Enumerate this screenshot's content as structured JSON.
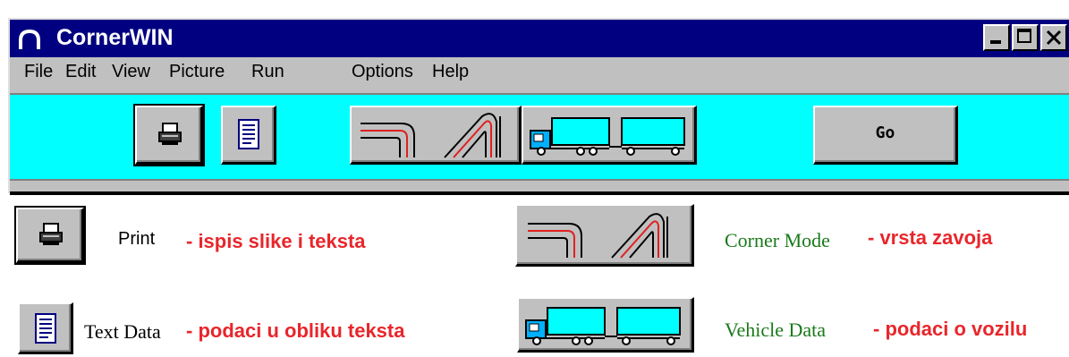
{
  "window": {
    "title": "CornerWIN",
    "controls": [
      "minimize",
      "maximize",
      "close"
    ]
  },
  "menu": {
    "items": [
      "File",
      "Edit",
      "View",
      "Picture",
      "Run",
      "Options",
      "Help"
    ]
  },
  "toolbar": {
    "go_label": "Go",
    "buttons": [
      "printer-icon",
      "text-document-icon",
      "corner-mode-icon",
      "vehicle-icon"
    ],
    "colors": {
      "background": "#00ffff",
      "button": "#c0c0c0",
      "titlebar": "#000080"
    }
  },
  "legend": {
    "print": {
      "label": "Print",
      "desc": "- ispis slike i teksta"
    },
    "text_data": {
      "label": "Text Data",
      "desc": "- podaci u obliku teksta"
    },
    "corner_mode": {
      "label": "Corner Mode",
      "desc": "- vrsta zavoja"
    },
    "vehicle_data": {
      "label": "Vehicle Data",
      "desc": "- podaci o vozilu"
    },
    "colors": {
      "description": "#e8262b",
      "label_green": "#1a7a1a"
    }
  }
}
